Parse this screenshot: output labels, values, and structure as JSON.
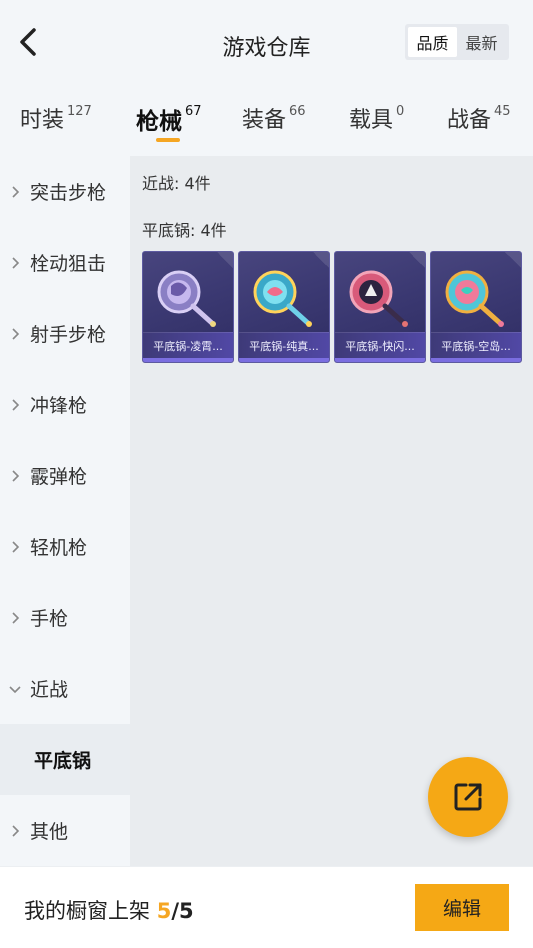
{
  "header": {
    "title": "游戏仓库",
    "sort_options": [
      "品质",
      "最新"
    ],
    "active_sort": "品质"
  },
  "tabs": [
    {
      "label": "时装",
      "count": "127"
    },
    {
      "label": "枪械",
      "count": "67"
    },
    {
      "label": "装备",
      "count": "66"
    },
    {
      "label": "载具",
      "count": "0"
    },
    {
      "label": "战备",
      "count": "45"
    }
  ],
  "active_tab": "枪械",
  "sidebar": {
    "items": [
      {
        "label": "突击步枪",
        "icon": "chevron-right-icon"
      },
      {
        "label": "栓动狙击",
        "icon": "chevron-right-icon"
      },
      {
        "label": "射手步枪",
        "icon": "chevron-right-icon"
      },
      {
        "label": "冲锋枪",
        "icon": "chevron-right-icon"
      },
      {
        "label": "霰弹枪",
        "icon": "chevron-right-icon"
      },
      {
        "label": "轻机枪",
        "icon": "chevron-right-icon"
      },
      {
        "label": "手枪",
        "icon": "chevron-right-icon"
      },
      {
        "label": "近战",
        "icon": "chevron-down-icon"
      }
    ],
    "sub_item": {
      "label": "平底锅"
    },
    "last_item": {
      "label": "其他",
      "icon": "chevron-right-icon"
    }
  },
  "content": {
    "category_title": "近战: 4件",
    "subcategory_title": "平底锅: 4件",
    "items": [
      {
        "name": "平底锅-凌霄...",
        "color": "#b39ddb"
      },
      {
        "name": "平底锅-纯真...",
        "color": "#4fc3f7"
      },
      {
        "name": "平底锅-快闪...",
        "color": "#e57373"
      },
      {
        "name": "平底锅-空岛...",
        "color": "#4dd0e1"
      }
    ]
  },
  "footer": {
    "label": "我的橱窗上架",
    "current": "5",
    "separator": "/",
    "max": "5",
    "edit_label": "编辑"
  },
  "colors": {
    "accent": "#f5a623",
    "sidebar_bg": "#f3f6f9",
    "content_bg": "#e9ecef",
    "card_bg": "#3a3871"
  }
}
